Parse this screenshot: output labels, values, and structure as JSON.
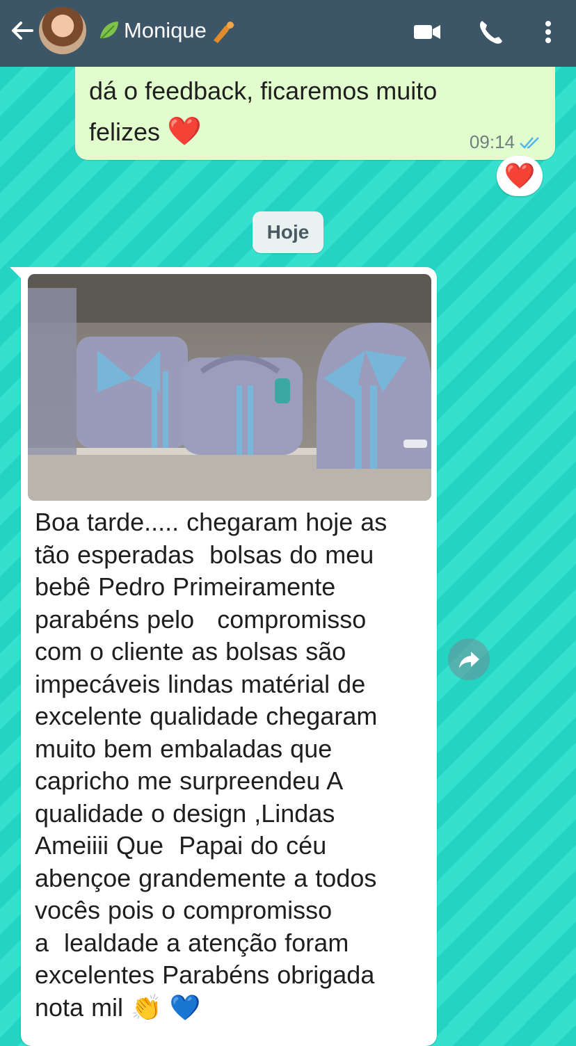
{
  "header": {
    "contact_name": "Monique",
    "leaf_icon": "leaf-icon",
    "hand_icon": "pointing-hand-icon",
    "icons": [
      "back-arrow-icon",
      "video-call-icon",
      "phone-icon",
      "more-vert-icon"
    ]
  },
  "messages": {
    "top_outgoing": {
      "text": "dá o feedback, ficaremos muito\nfelizes",
      "emoji": "❤️",
      "time": "09:14",
      "reaction": "❤️"
    },
    "date_separator": "Hoje",
    "incoming": {
      "text": "Boa tarde..... chegaram hoje as\ntão esperadas  bolsas do meu\nbebê Pedro Primeiramente\nparabéns pelo   compromisso\ncom o cliente as bolsas são\nimpecáveis lindas matérial de\nexcelente qualidade chegaram\nmuito bem embaladas que\ncapricho me surpreendeu A\nqualidade o design ,Lindas\nAmeiiii Que  Papai do céu\nabençoe grandemente a todos\nvocês pois o compromisso\na  lealdade a atenção foram\nexcelentes Parabéns obrigada\nnota mil 👏 💙"
    }
  },
  "colors": {
    "header": "#3d5667",
    "outgoing_bubble": "#e2fdcd",
    "incoming_bubble": "#ffffff",
    "wallpaper": "#35e0cf",
    "read_ticks": "#4fb6ec"
  }
}
